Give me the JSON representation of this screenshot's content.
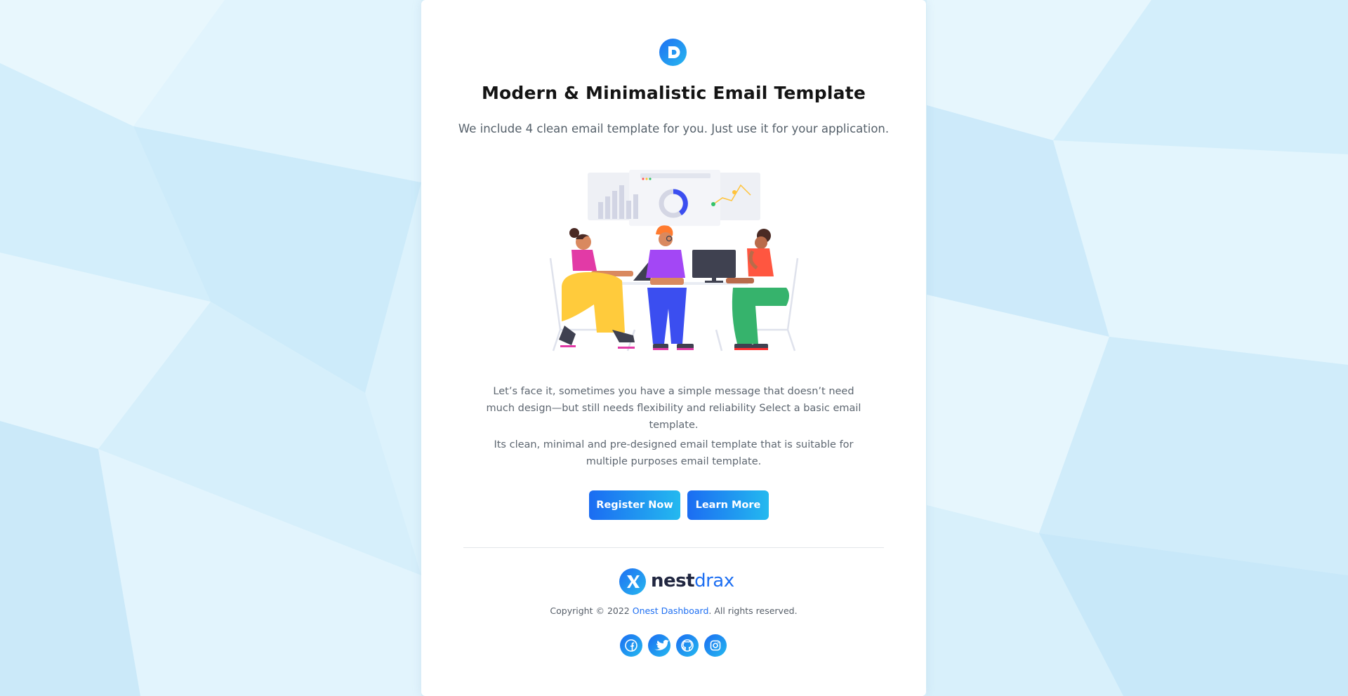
{
  "email": {
    "title": "Modern & Minimalistic Email Template",
    "subtitle": "We include 4 clean email template for you. Just use it for your application.",
    "paragraph_1": "Let’s face it, sometimes you have a simple message that doesn’t need much design—but still needs flexibility and reliability Select a basic email template.",
    "paragraph_2": "Its clean, minimal and pre-designed email template that is suitable for multiple purposes email template.",
    "buttons": {
      "register": "Register Now",
      "learn_more": "Learn More"
    },
    "illustration_icon": "team-meeting-illustration"
  },
  "footer": {
    "brand_prefix": "nest",
    "brand_suffix": "drax",
    "copyright_prefix": "Copyright © 2022 ",
    "copyright_link": "Onest Dashboard",
    "copyright_suffix": ". All rights reserved.",
    "social": [
      "facebook-icon",
      "twitter-icon",
      "github-icon",
      "instagram-icon"
    ]
  },
  "colors": {
    "accent": "#1E6FF2",
    "accent_light": "#27B8F0",
    "background": "#DFF3FC",
    "card": "#FFFFFF",
    "title": "#141414",
    "body_text": "#5D6670"
  }
}
